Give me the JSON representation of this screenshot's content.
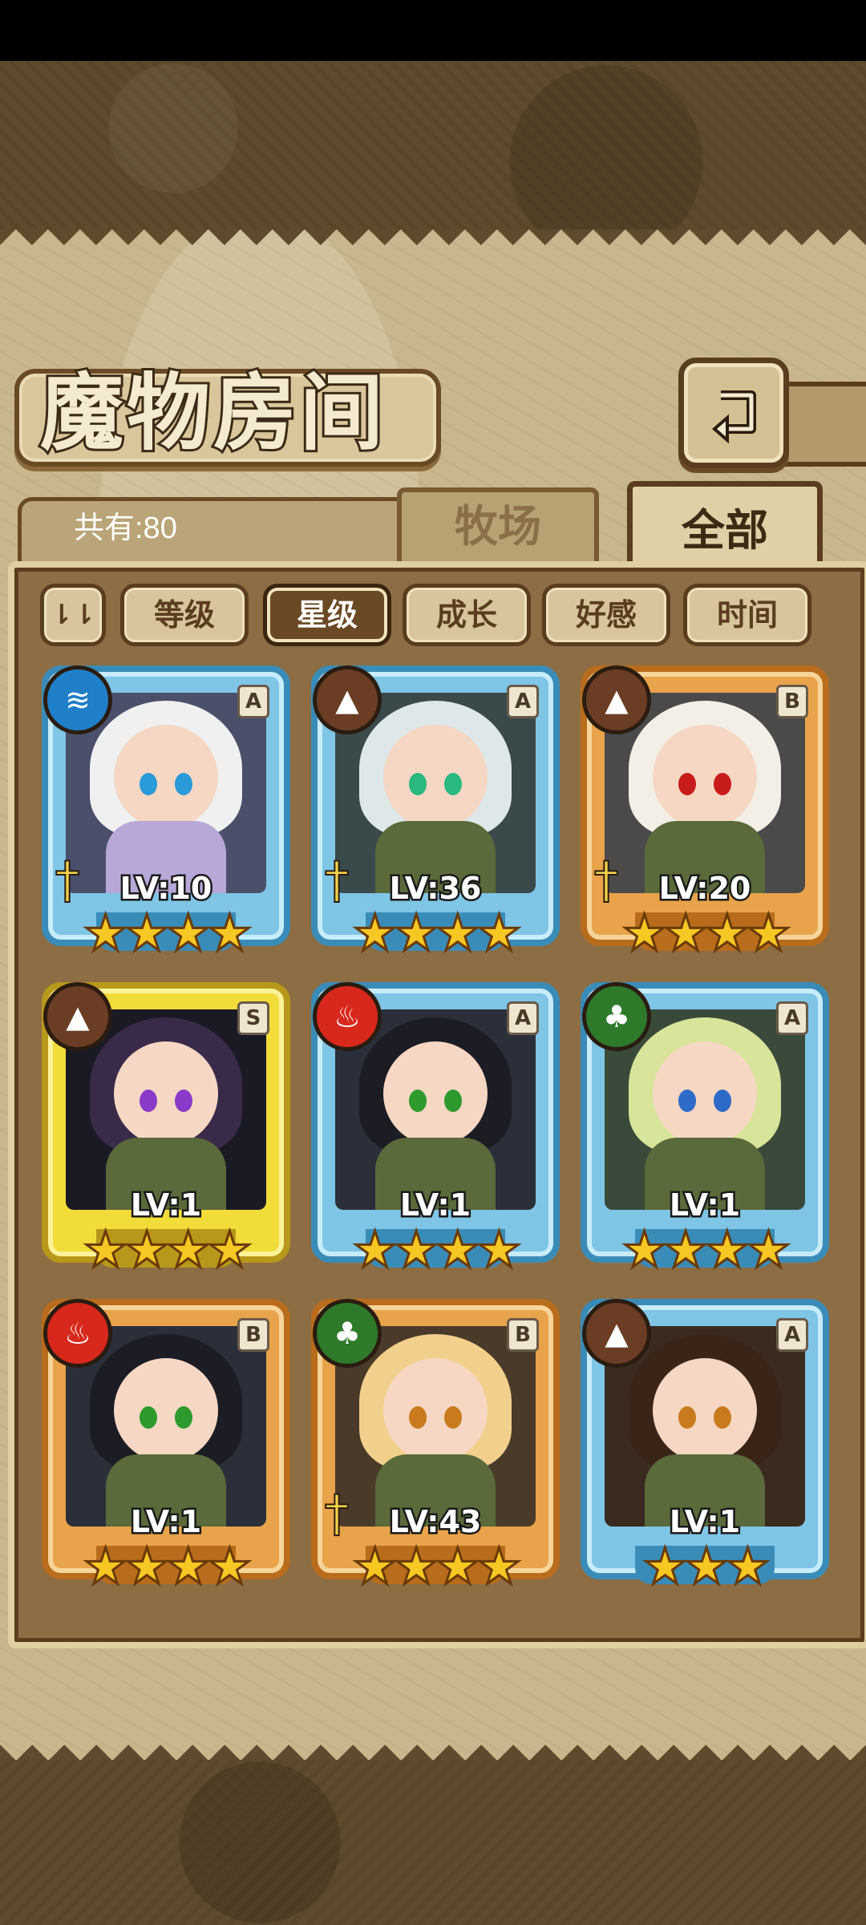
{
  "screen": {
    "title": "魔物房间",
    "total_count": "共有:80",
    "back_icon": "return-arrow-icon"
  },
  "tabs": [
    {
      "label": "牧场",
      "active": false
    },
    {
      "label": "全部",
      "active": true
    }
  ],
  "sort": {
    "order_icon": "sort-order-icon",
    "buttons": [
      {
        "label": "等级",
        "active": false
      },
      {
        "label": "星级",
        "active": true
      },
      {
        "label": "成长",
        "active": false
      },
      {
        "label": "好感",
        "active": false
      },
      {
        "label": "时间",
        "active": false
      }
    ]
  },
  "colors": {
    "blue_frame": "#3a8cb8",
    "orange_frame": "#b86c1c",
    "gold_frame": "#b8981a",
    "water": "#1f7fc8",
    "earth": "#6a3d24",
    "fire": "#d8281c",
    "nature": "#2e7a2a",
    "star": "#f7c823"
  },
  "monsters": [
    {
      "level": "LV:10",
      "rank": "A",
      "frame": "blue",
      "element": "water",
      "stars": "★★★★",
      "equipped": true
    },
    {
      "level": "LV:36",
      "rank": "A",
      "frame": "blue",
      "element": "earth",
      "stars": "★★★★",
      "equipped": true
    },
    {
      "level": "LV:20",
      "rank": "B",
      "frame": "orange",
      "element": "earth",
      "stars": "★★★★",
      "equipped": true
    },
    {
      "level": "LV:1",
      "rank": "S",
      "frame": "gold",
      "element": "earth",
      "stars": "★★★★",
      "equipped": false
    },
    {
      "level": "LV:1",
      "rank": "A",
      "frame": "blue",
      "element": "fire",
      "stars": "★★★★",
      "equipped": false
    },
    {
      "level": "LV:1",
      "rank": "A",
      "frame": "blue",
      "element": "nature",
      "stars": "★★★★",
      "equipped": false
    },
    {
      "level": "LV:1",
      "rank": "B",
      "frame": "orange",
      "element": "fire",
      "stars": "★★★★",
      "equipped": false
    },
    {
      "level": "LV:43",
      "rank": "B",
      "frame": "orange",
      "element": "nature",
      "stars": "★★★★",
      "equipped": true
    },
    {
      "level": "LV:1",
      "rank": "A",
      "frame": "blue",
      "element": "earth",
      "stars": "★★★",
      "equipped": false
    }
  ]
}
